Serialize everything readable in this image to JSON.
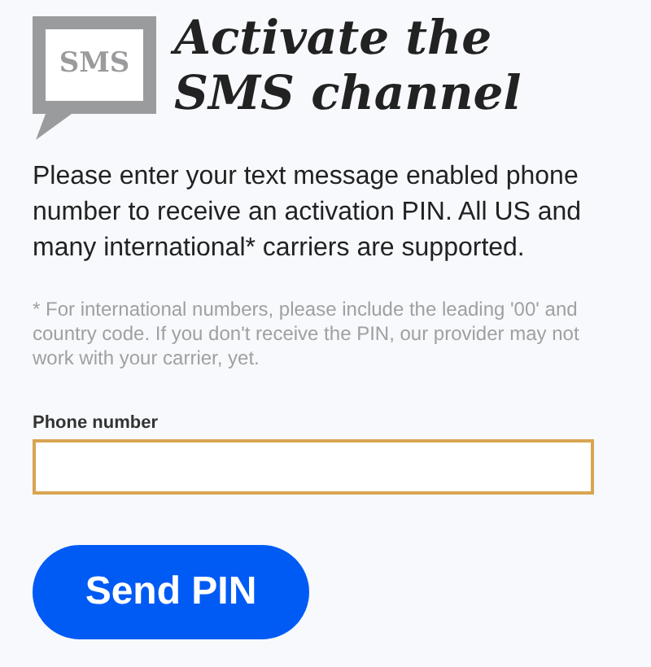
{
  "icon_label": "SMS",
  "title": "Activate the SMS channel",
  "intro": "Please enter your text message enabled phone number to receive an activation PIN. All US and many international* carriers are supported.",
  "note": "* For international numbers, please include the leading '00' and country code. If you don't receive the PIN, our provider may not work with your carrier, yet.",
  "phone_field": {
    "label": "Phone number",
    "focused": true
  },
  "buttons": [
    "Send PIN"
  ]
}
